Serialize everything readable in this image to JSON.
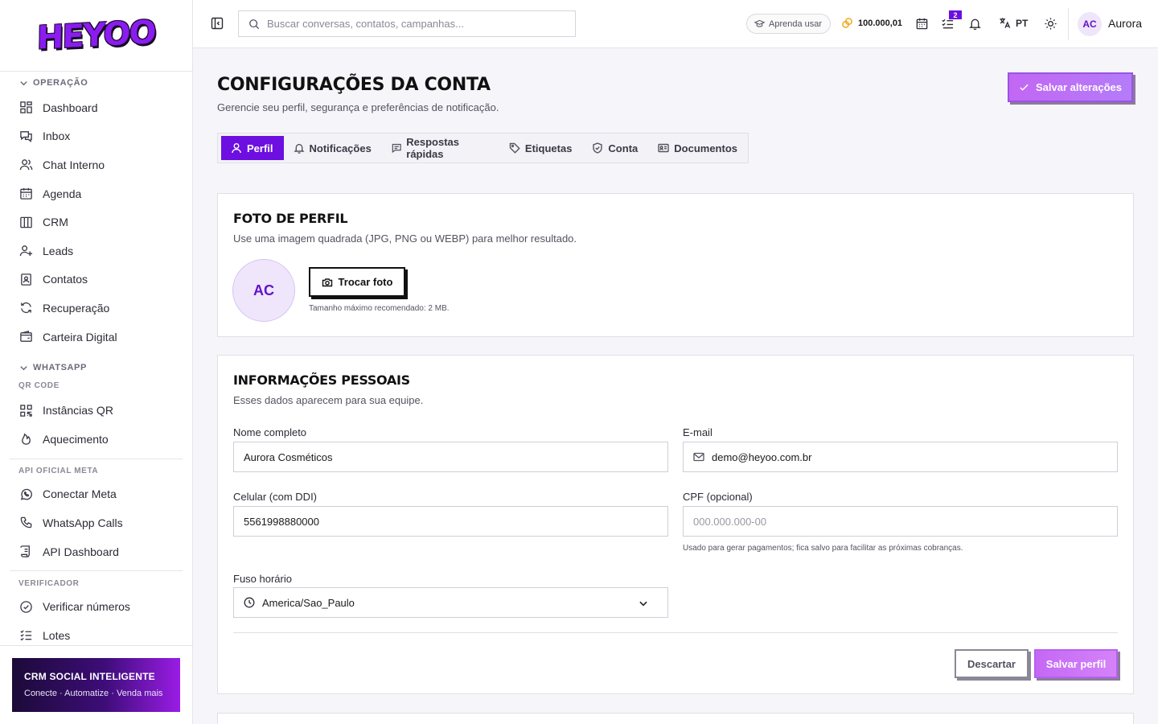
{
  "brand": {
    "logo_text": "HEYOO",
    "accent": "#6c0fe0",
    "accent_light": "#c267f4"
  },
  "sidebar": {
    "sections": [
      {
        "title": "OPERAÇÃO",
        "items": [
          "Dashboard",
          "Inbox",
          "Chat Interno",
          "Agenda",
          "CRM",
          "Leads",
          "Contatos",
          "Recuperação",
          "Carteira Digital"
        ]
      },
      {
        "title": "WHATSAPP",
        "subsection": "QR CODE",
        "items": [
          "Instâncias QR",
          "Aquecimento"
        ]
      },
      {
        "subsection": "API OFICIAL META",
        "items": [
          "Conectar Meta",
          "WhatsApp Calls",
          "API Dashboard"
        ]
      },
      {
        "subsection": "VERIFICADOR",
        "items": [
          "Verificar números",
          "Lotes"
        ]
      }
    ],
    "promo": {
      "title": "CRM SOCIAL INTELIGENTE",
      "subtitle": "Conecte · Automatize · Venda mais"
    }
  },
  "topbar": {
    "search_placeholder": "Buscar conversas, contatos, campanhas...",
    "learn_label": "Aprenda usar",
    "credits": "100.000,01",
    "tasks_badge": "2",
    "language": "PT",
    "user_initials": "AC",
    "user_name": "Aurora"
  },
  "page": {
    "title": "CONFIGURAÇÕES DA CONTA",
    "subtitle": "Gerencie seu perfil, segurança e preferências de notificação.",
    "save_all_label": "Salvar alterações",
    "tabs": [
      "Perfil",
      "Notificações",
      "Respostas rápidas",
      "Etiquetas",
      "Conta",
      "Documentos"
    ]
  },
  "photo_card": {
    "title": "FOTO DE PERFIL",
    "subtitle": "Use uma imagem quadrada (JPG, PNG ou WEBP) para melhor resultado.",
    "initials": "AC",
    "change_label": "Trocar foto",
    "hint": "Tamanho máximo recomendado: 2 MB."
  },
  "personal_card": {
    "title": "INFORMAÇÕES PESSOAIS",
    "subtitle": "Esses dados aparecem para sua equipe.",
    "name_label": "Nome completo",
    "name_value": "Aurora Cosméticos",
    "email_label": "E-mail",
    "email_value": "demo@heyoo.com.br",
    "phone_label": "Celular (com DDI)",
    "phone_value": "5561998880000",
    "cpf_label": "CPF (opcional)",
    "cpf_placeholder": "000.000.000-00",
    "cpf_hint": "Usado para gerar pagamentos; fica salvo para facilitar as próximas cobranças.",
    "tz_label": "Fuso horário",
    "tz_value": "America/Sao_Paulo",
    "discard_label": "Descartar",
    "save_label": "Salvar perfil"
  }
}
